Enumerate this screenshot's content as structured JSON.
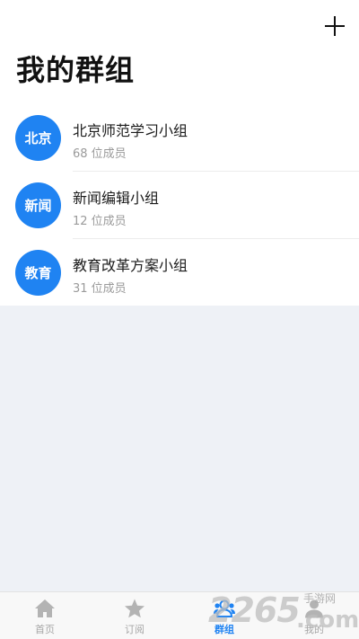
{
  "header": {
    "title": "我的群组",
    "add_icon": "plus-icon"
  },
  "groups": [
    {
      "avatar_text": "北京",
      "name": "北京师范学习小组",
      "members": "68 位成员"
    },
    {
      "avatar_text": "新闻",
      "name": "新闻编辑小组",
      "members": "12 位成员"
    },
    {
      "avatar_text": "教育",
      "name": "教育改革方案小组",
      "members": "31 位成员"
    }
  ],
  "tabbar": {
    "tabs": [
      {
        "label": "首页",
        "icon": "home-icon",
        "active": false
      },
      {
        "label": "订阅",
        "icon": "star-icon",
        "active": false
      },
      {
        "label": "群组",
        "icon": "group-icon",
        "active": true
      },
      {
        "label": "我的",
        "icon": "user-icon",
        "active": false
      }
    ]
  },
  "watermark": {
    "number": "2265",
    "domain": ".com",
    "site_cn": "手游网"
  },
  "colors": {
    "accent": "#1f83f2",
    "background": "#eef1f6",
    "tab_inactive": "#a6a6a6"
  }
}
